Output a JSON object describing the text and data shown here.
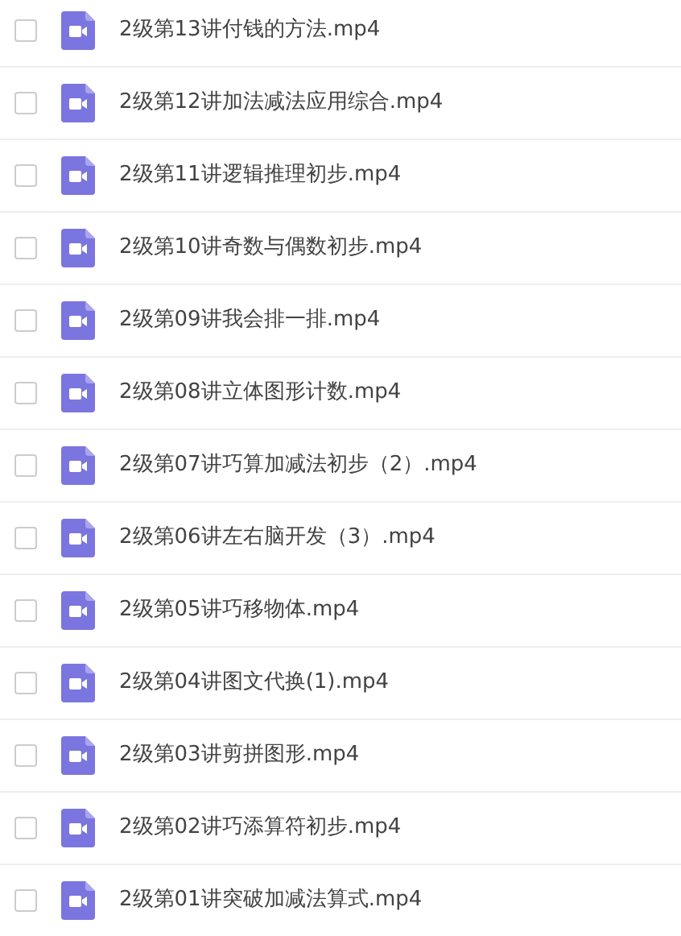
{
  "files": [
    {
      "name": "2级第13讲付钱的方法.mp4",
      "checked": false
    },
    {
      "name": "2级第12讲加法减法应用综合.mp4",
      "checked": false
    },
    {
      "name": "2级第11讲逻辑推理初步.mp4",
      "checked": false
    },
    {
      "name": "2级第10讲奇数与偶数初步.mp4",
      "checked": false
    },
    {
      "name": "2级第09讲我会排一排.mp4",
      "checked": false
    },
    {
      "name": "2级第08讲立体图形计数.mp4",
      "checked": false
    },
    {
      "name": "2级第07讲巧算加减法初步（2）.mp4",
      "checked": false
    },
    {
      "name": "2级第06讲左右脑开发（3）.mp4",
      "checked": false
    },
    {
      "name": "2级第05讲巧移物体.mp4",
      "checked": false
    },
    {
      "name": "2级第04讲图文代换(1).mp4",
      "checked": false
    },
    {
      "name": "2级第03讲剪拼图形.mp4",
      "checked": false
    },
    {
      "name": "2级第02讲巧添算符初步.mp4",
      "checked": false
    },
    {
      "name": "2级第01讲突破加减法算式.mp4",
      "checked": false
    }
  ]
}
